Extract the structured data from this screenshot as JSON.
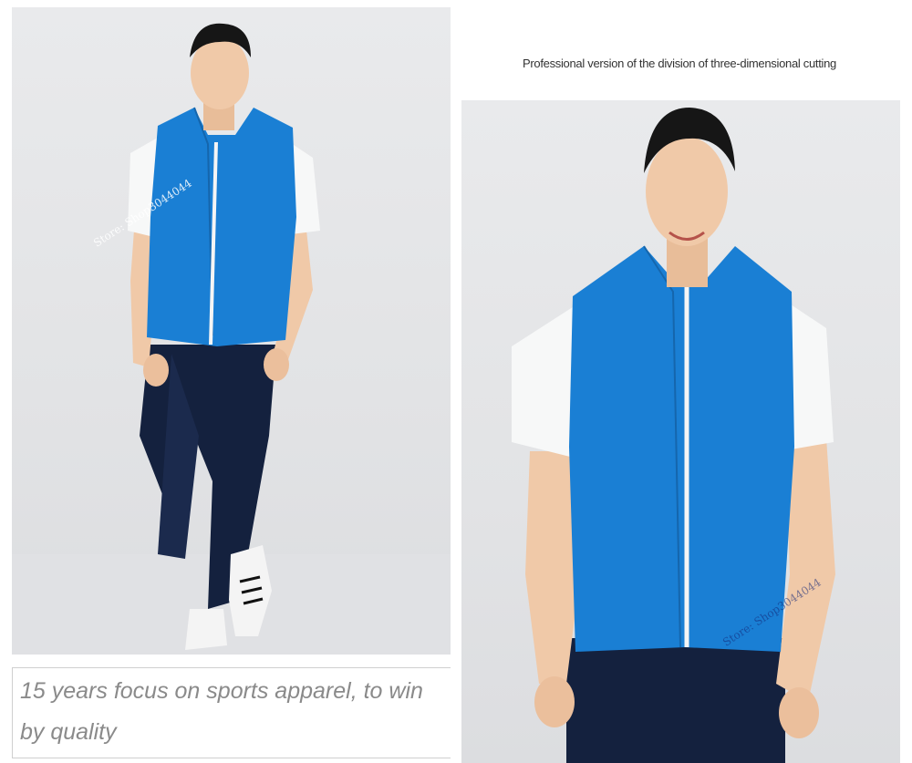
{
  "header": {
    "caption": "Professional version of the division of three-dimensional cutting"
  },
  "slogan": {
    "text": "15 years focus on sports apparel, to win by quality"
  },
  "watermarks": {
    "left": "Store: Shop3044044",
    "right": "Store: Shop3044044"
  },
  "colors": {
    "vest": "#1a7fd4",
    "shirt": "#f7f8f8",
    "jeans": "#14213e",
    "background": "#e6e7e9",
    "text": "#333333",
    "slogan": "#8a8a8a"
  }
}
